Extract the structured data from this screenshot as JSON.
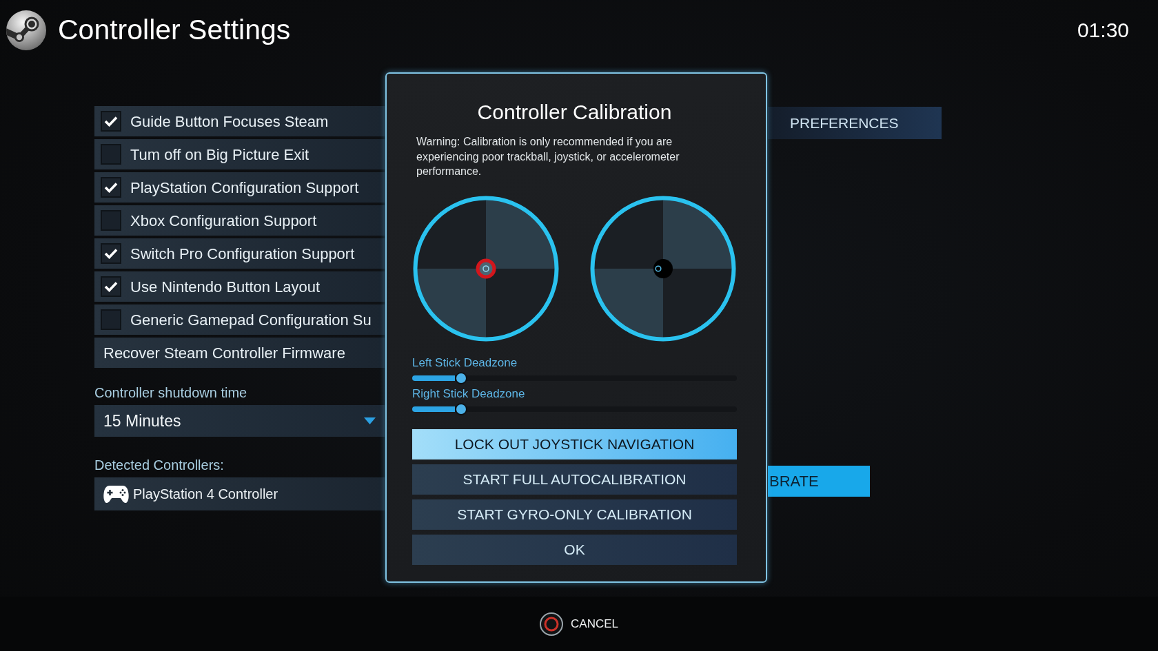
{
  "header": {
    "title": "Controller Settings",
    "clock": "01:30"
  },
  "settings": {
    "options": [
      {
        "label": "Guide Button Focuses Steam",
        "checked": true
      },
      {
        "label": "Tum off on Big Picture Exit",
        "checked": false
      },
      {
        "label": "PlayStation Configuration Support",
        "checked": true
      },
      {
        "label": "Xbox Configuration Support",
        "checked": false
      },
      {
        "label": "Switch Pro Configuration Support",
        "checked": true
      },
      {
        "label": "Use Nintendo Button Layout",
        "checked": true
      },
      {
        "label": "Generic Gamepad Configuration Su",
        "checked": false
      }
    ],
    "firmware_button": "Recover Steam Controller Firmware",
    "shutdown_time": {
      "label": "Controller shutdown time",
      "value": "15 Minutes"
    },
    "detected_controllers": {
      "label": "Detected Controllers:",
      "items": [
        "PlayStation 4 Controller"
      ]
    }
  },
  "side_panel": {
    "tabs": [
      {
        "label": "PREFERENCES",
        "selected": false
      }
    ],
    "button": "BRATE"
  },
  "dialog": {
    "title": "Controller Calibration",
    "warning": "Warning: Calibration is only recommended if you are experiencing poor trackball, joystick, or accelerometer performance.",
    "sticks": [
      {
        "highlighted": true
      },
      {
        "highlighted": false
      }
    ],
    "sliders": [
      {
        "label": "Left Stick Deadzone",
        "level": 0.15
      },
      {
        "label": "Right Stick Deadzone",
        "level": 0.15
      }
    ],
    "buttons": [
      {
        "label": "LOCK OUT JOYSTICK NAVIGATION",
        "selected": true
      },
      {
        "label": "START FULL AUTOCALIBRATION",
        "selected": false
      },
      {
        "label": "START GYRO-ONLY CALIBRATION",
        "selected": false
      },
      {
        "label": "OK",
        "selected": false
      }
    ]
  },
  "footer": {
    "cancel": "CANCEL"
  }
}
